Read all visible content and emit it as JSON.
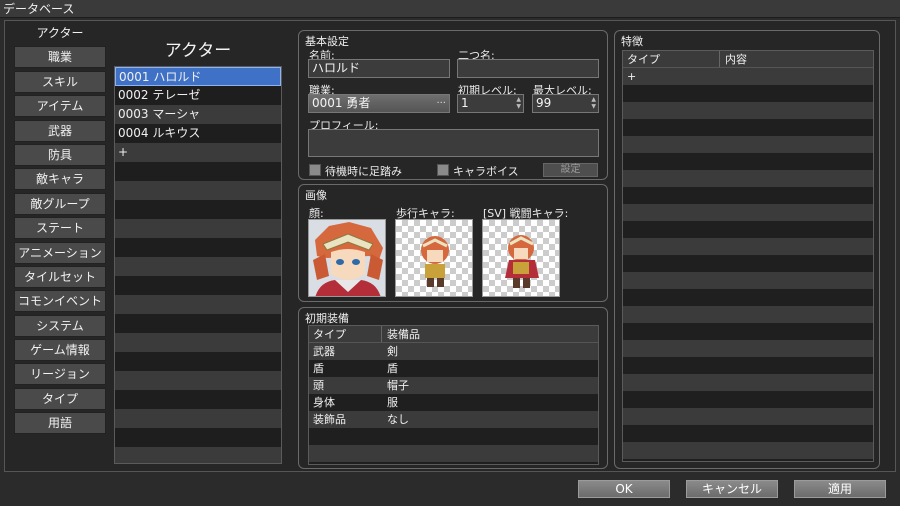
{
  "window": {
    "title": "データベース"
  },
  "categories": [
    "アクター",
    "職業",
    "スキル",
    "アイテム",
    "武器",
    "防具",
    "敵キャラ",
    "敵グループ",
    "ステート",
    "アニメーション",
    "タイルセット",
    "コモンイベント",
    "システム",
    "ゲーム情報",
    "リージョン",
    "タイプ",
    "用語"
  ],
  "actor_list": {
    "title": "アクター",
    "items": [
      "0001 ハロルド",
      "0002 テレーゼ",
      "0003 マーシャ",
      "0004 ルキウス"
    ],
    "add_symbol": "+"
  },
  "basic": {
    "title": "基本設定",
    "name_label": "名前:",
    "name_value": "ハロルド",
    "nickname_label": "二つ名:",
    "nickname_value": "",
    "class_label": "職業:",
    "class_value": "0001 勇者",
    "class_ellipsis": "...",
    "init_level_label": "初期レベル:",
    "init_level_value": "1",
    "max_level_label": "最大レベル:",
    "max_level_value": "99",
    "profile_label": "プロフィール:",
    "profile_value": "",
    "step_anime_label": "待機時に足踏み",
    "chara_voice_label": "キャラボイス",
    "setting_button": "設定"
  },
  "images": {
    "title": "画像",
    "face_label": "顔:",
    "walk_label": "歩行キャラ:",
    "battler_label": "[SV] 戦闘キャラ:"
  },
  "equipment": {
    "title": "初期装備",
    "headers": [
      "タイプ",
      "装備品"
    ],
    "rows": [
      [
        "武器",
        "剣"
      ],
      [
        "盾",
        "盾"
      ],
      [
        "頭",
        "帽子"
      ],
      [
        "身体",
        "服"
      ],
      [
        "装飾品",
        "なし"
      ]
    ]
  },
  "traits": {
    "title": "特徴",
    "headers": [
      "タイプ",
      "内容"
    ],
    "add_symbol": "+"
  },
  "footer": {
    "ok": "OK",
    "cancel": "キャンセル",
    "apply": "適用"
  },
  "colors": {
    "selection": "#3f72c6",
    "background": "#262626",
    "row_alt": "#3b3b3b"
  }
}
